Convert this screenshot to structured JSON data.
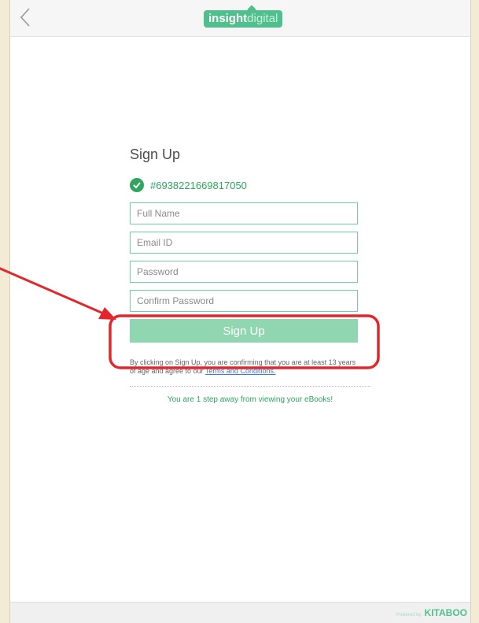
{
  "header": {
    "back_icon": "chevron-left-icon",
    "logo_bold": "insight",
    "logo_light": "digital"
  },
  "form": {
    "title": "Sign Up",
    "verified_icon": "check-circle-icon",
    "access_code": "#6938221669817050",
    "fields": {
      "full_name": "Full Name",
      "email": "Email ID",
      "password": "Password",
      "confirm_password": "Confirm Password"
    },
    "submit_label": "Sign Up",
    "terms_text": "By clicking on Sign Up, you are confirming that you are at least 13 years of age and agree to our ",
    "terms_link": "Terms and Conditions.",
    "step_message": "You are 1 step away from viewing your eBooks!"
  },
  "footer": {
    "powered_by": "Powered by",
    "brand": "KITABOO"
  },
  "colors": {
    "accent": "#4fc08d",
    "button": "#8fd6b1",
    "annotation": "#e3262c",
    "frame": "#f3ebd6"
  }
}
